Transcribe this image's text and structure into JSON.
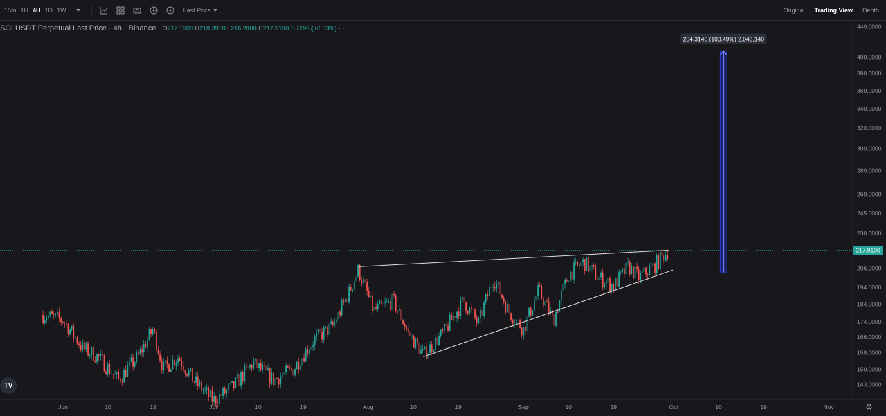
{
  "toolbar": {
    "timeframes": [
      "15m",
      "1H",
      "4H",
      "1D",
      "1W"
    ],
    "active_timeframe": "4H",
    "price_type": "Last Price",
    "views": [
      "Original",
      "Trading View",
      "Depth"
    ],
    "active_view": "Trading View"
  },
  "legend": {
    "symbol_line": "SOLUSDT Perpetual Last Price · 4h · Binance",
    "open_key": "O",
    "open": "217.1900",
    "high_key": "H",
    "high": "218.3900",
    "low_key": "L",
    "low": "216.2000",
    "close_key": "C",
    "close": "217.9100",
    "change": "0.7199 (+0.33%)",
    "more": "· · ·"
  },
  "colors": {
    "background": "#17171c",
    "up": "#26a69a",
    "down": "#ef5350",
    "measure": "#2a3ad6",
    "trendline": "#e0e0e0",
    "last_price": "#26a69a"
  },
  "chart_data": {
    "type": "candlestick",
    "symbol": "SOLUSDT",
    "interval": "4h",
    "y_axis_scale": "log",
    "y_ticks": [
      "440.0000",
      "400.0000",
      "380.0000",
      "360.0000",
      "340.0000",
      "320.0000",
      "300.0000",
      "280.0000",
      "260.0000",
      "245.0000",
      "230.0000",
      "206.0000",
      "194.0000",
      "184.0000",
      "174.0000",
      "166.0000",
      "158.0000",
      "150.0000",
      "143.0000"
    ],
    "x_ticks": [
      "Jun",
      "10",
      "19",
      "Jul",
      "10",
      "19",
      "Aug",
      "10",
      "19",
      "Sep",
      "10",
      "19",
      "Oct",
      "10",
      "19",
      "Nov"
    ],
    "last_price": 217.91,
    "last_price_label": "217.9100",
    "price_path": [
      [
        "2024-05-28",
        178
      ],
      [
        "2024-06-01",
        175
      ],
      [
        "2024-06-05",
        160
      ],
      [
        "2024-06-08",
        156
      ],
      [
        "2024-06-12",
        145
      ],
      [
        "2024-06-16",
        156
      ],
      [
        "2024-06-19",
        170
      ],
      [
        "2024-06-21",
        150
      ],
      [
        "2024-06-24",
        156
      ],
      [
        "2024-06-27",
        145
      ],
      [
        "2024-07-01",
        136
      ],
      [
        "2024-07-05",
        142
      ],
      [
        "2024-07-09",
        153
      ],
      [
        "2024-07-13",
        145
      ],
      [
        "2024-07-17",
        150
      ],
      [
        "2024-07-21",
        164
      ],
      [
        "2024-07-25",
        172
      ],
      [
        "2024-07-28",
        190
      ],
      [
        "2024-07-30",
        205
      ],
      [
        "2024-08-02",
        180
      ],
      [
        "2024-08-06",
        186
      ],
      [
        "2024-08-09",
        168
      ],
      [
        "2024-08-12",
        157
      ],
      [
        "2024-08-16",
        168
      ],
      [
        "2024-08-20",
        186
      ],
      [
        "2024-08-23",
        173
      ],
      [
        "2024-08-26",
        200
      ],
      [
        "2024-08-29",
        180
      ],
      [
        "2024-09-01",
        170
      ],
      [
        "2024-09-04",
        192
      ],
      [
        "2024-09-07",
        175
      ],
      [
        "2024-09-10",
        202
      ],
      [
        "2024-09-13",
        210
      ],
      [
        "2024-09-16",
        200
      ],
      [
        "2024-09-19",
        195
      ],
      [
        "2024-09-22",
        207
      ],
      [
        "2024-09-24",
        200
      ],
      [
        "2024-09-27",
        207
      ],
      [
        "2024-09-30",
        218
      ]
    ],
    "trendlines": [
      {
        "name": "upper",
        "from": [
          "2024-07-30",
          207
        ],
        "to": [
          "2024-09-30",
          218
        ]
      },
      {
        "name": "lower",
        "from": [
          "2024-08-12",
          156
        ],
        "to": [
          "2024-10-01",
          205
        ]
      }
    ],
    "measure": {
      "from_price": 203.5,
      "to_price": 407.8,
      "date": "2024-10-11",
      "label": "204.3140 (100.49%) 2,043,140"
    }
  }
}
